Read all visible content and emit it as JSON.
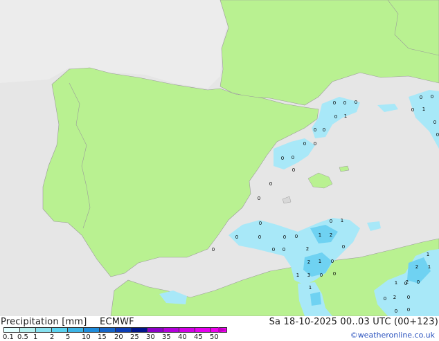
{
  "footer": {
    "title": "Precipitation [mm]",
    "model": "ECMWF",
    "run_info": "Sa 18-10-2025 00..03 UTC (00+123)",
    "copyright": "©weatheronline.co.uk"
  },
  "scale": {
    "labels": [
      "0.1",
      "0.5",
      "1",
      "2",
      "5",
      "10",
      "15",
      "20",
      "25",
      "30",
      "35",
      "40",
      "45",
      "50"
    ],
    "colors": [
      "#e0ffff",
      "#b4f0f0",
      "#87e1f0",
      "#5ad2f0",
      "#3cb4e6",
      "#1e8cdc",
      "#1464c8",
      "#0a3cb4",
      "#00148c",
      "#8c00c8",
      "#b400dc",
      "#d200e6",
      "#e600f0",
      "#f000f0"
    ],
    "units": "mm"
  },
  "map": {
    "land_color": "#b9f191",
    "sea_color": "#e6e6e6",
    "outside_color": "#ececec",
    "border_color": "#9a9a9a",
    "precip_light_color": "#a8e8f8",
    "precip_mid_color": "#6fd2f2",
    "cell_labels": [
      "0",
      "0",
      "0",
      "0",
      "1",
      "0",
      "0",
      "0",
      "1",
      "0",
      "0",
      "0",
      "0",
      "0",
      "0",
      "0",
      "0",
      "0",
      "0",
      "0",
      "0",
      "0",
      "0",
      "0",
      "1",
      "0",
      "0",
      "0",
      "1",
      "2",
      "0",
      "0",
      "2",
      "0",
      "2",
      "1",
      "0",
      "1",
      "3",
      "0",
      "0",
      "2",
      "1",
      "0",
      "1",
      "2",
      "0",
      "1",
      "2",
      "0",
      "0",
      "0",
      "0",
      "1"
    ]
  }
}
